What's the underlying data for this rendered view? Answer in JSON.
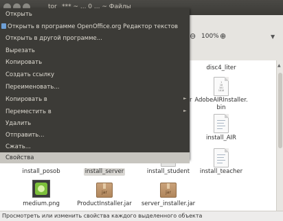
{
  "window": {
    "title": "tor_ *** ~ ... 0 ... ~ Файлы"
  },
  "toolbar": {
    "zoom_level": "100%",
    "zoom_out_icon": "zoom-out",
    "zoom_in_icon": "zoom-in",
    "dropdown_icon": "chevron-down"
  },
  "context_menu": {
    "items": [
      {
        "label": "Открыть"
      },
      {
        "label": "Открыть в программе OpenOffice.org Редактор текстов",
        "icon": "openoffice-writer"
      },
      {
        "label": "Открыть в другой программе..."
      },
      {
        "label": "Вырезать"
      },
      {
        "label": "Копировать"
      },
      {
        "label": "Создать ссылку"
      },
      {
        "label": "Переименовать..."
      },
      {
        "label": "Копировать в",
        "submenu": true
      },
      {
        "label": "Переместить в",
        "submenu": true
      },
      {
        "label": "Удалить"
      },
      {
        "label": "Отправить..."
      },
      {
        "label": "Сжать..."
      },
      {
        "label": "Свойства",
        "highlighted": true
      }
    ]
  },
  "files": {
    "disc4_liter": "disc4_liter",
    "partial_r": "r",
    "adobeair": "AdobeAIRInstaller.\nbin",
    "install_air": "install_AIR",
    "install_posob": "install_posob",
    "install_server": "install_server",
    "install_student": "install_student",
    "install_teacher": "install_teacher",
    "medium": "medium.png",
    "productinstaller": "ProductInstaller.jar",
    "server_installer": "server_installer.jar",
    "jar_badge": "jar",
    "bin_lines": "1\n10\n101\n1010"
  },
  "statusbar": {
    "text": "Просмотреть или изменить свойства каждого выделенного объекта"
  },
  "colors": {
    "menu_bg": "#3c3b37",
    "menu_text": "#dfdbd2",
    "highlight": "#c7c5bf",
    "selection": "#d9d7d3"
  }
}
